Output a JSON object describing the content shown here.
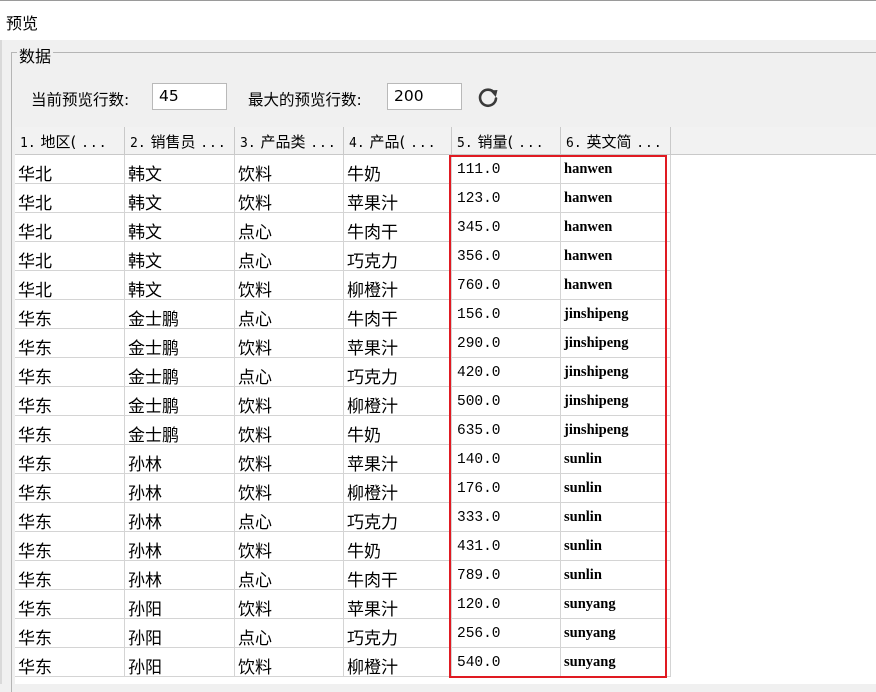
{
  "window": {
    "title": "预览"
  },
  "group": {
    "label": "数据"
  },
  "controls": {
    "current_rows_label": "当前预览行数:",
    "current_rows_value": "45",
    "max_rows_label": "最大的预览行数:",
    "max_rows_value": "200",
    "refresh_icon": "refresh-icon"
  },
  "table": {
    "columns": [
      {
        "num": "1.",
        "name": "地区(",
        "dots": "..."
      },
      {
        "num": "2.",
        "name": "销售员",
        "dots": "..."
      },
      {
        "num": "3.",
        "name": "产品类",
        "dots": "..."
      },
      {
        "num": "4.",
        "name": "产品(",
        "dots": "..."
      },
      {
        "num": "5.",
        "name": "销量(",
        "dots": "..."
      },
      {
        "num": "6.",
        "name": "英文简",
        "dots": "..."
      }
    ],
    "rows": [
      [
        "华北",
        "韩文",
        "饮料",
        "牛奶",
        "111.0",
        "hanwen"
      ],
      [
        "华北",
        "韩文",
        "饮料",
        "苹果汁",
        "123.0",
        "hanwen"
      ],
      [
        "华北",
        "韩文",
        "点心",
        "牛肉干",
        "345.0",
        "hanwen"
      ],
      [
        "华北",
        "韩文",
        "点心",
        "巧克力",
        "356.0",
        "hanwen"
      ],
      [
        "华北",
        "韩文",
        "饮料",
        "柳橙汁",
        "760.0",
        "hanwen"
      ],
      [
        "华东",
        "金士鹏",
        "点心",
        "牛肉干",
        "156.0",
        "jinshipeng"
      ],
      [
        "华东",
        "金士鹏",
        "饮料",
        "苹果汁",
        "290.0",
        "jinshipeng"
      ],
      [
        "华东",
        "金士鹏",
        "点心",
        "巧克力",
        "420.0",
        "jinshipeng"
      ],
      [
        "华东",
        "金士鹏",
        "饮料",
        "柳橙汁",
        "500.0",
        "jinshipeng"
      ],
      [
        "华东",
        "金士鹏",
        "饮料",
        "牛奶",
        "635.0",
        "jinshipeng"
      ],
      [
        "华东",
        "孙林",
        "饮料",
        "苹果汁",
        "140.0",
        "sunlin"
      ],
      [
        "华东",
        "孙林",
        "饮料",
        "柳橙汁",
        "176.0",
        "sunlin"
      ],
      [
        "华东",
        "孙林",
        "点心",
        "巧克力",
        "333.0",
        "sunlin"
      ],
      [
        "华东",
        "孙林",
        "饮料",
        "牛奶",
        "431.0",
        "sunlin"
      ],
      [
        "华东",
        "孙林",
        "点心",
        "牛肉干",
        "789.0",
        "sunlin"
      ],
      [
        "华东",
        "孙阳",
        "饮料",
        "苹果汁",
        "120.0",
        "sunyang"
      ],
      [
        "华东",
        "孙阳",
        "点心",
        "巧克力",
        "256.0",
        "sunyang"
      ],
      [
        "华东",
        "孙阳",
        "饮料",
        "柳橙汁",
        "540.0",
        "sunyang"
      ]
    ]
  },
  "colors": {
    "highlight": "#e01a22",
    "header_bg": "#f2f2f2",
    "grid_line": "#d4d4d4"
  }
}
